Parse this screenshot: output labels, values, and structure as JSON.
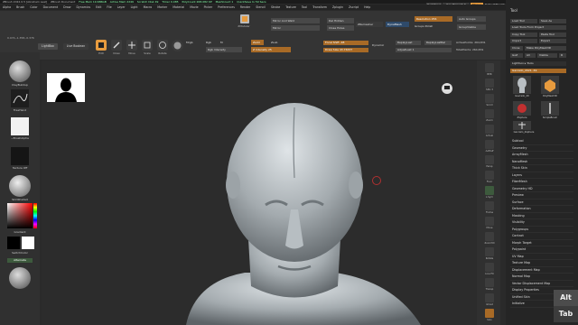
{
  "title_bar": {
    "app": "ZBrush 2022.0.5 [Abraham Leal]",
    "document": "ZBrush Document",
    "free_mem": "Free Mem 19.686GB",
    "active_mem": "Active Mem 2249",
    "scratch_disk": "Scratch Disk 49",
    "timer": "Timer 0.085",
    "poly_count": "PolyCount 268.082 KP",
    "mesh_count": "MeshCount 1",
    "quicksave": "QuickSave In 59 Secs",
    "quicksave_btn": "QuickSave",
    "see_through": "See-through 0",
    "menus_btn": "Menus",
    "default_script": "DefaultZScript"
  },
  "menubar": [
    "Alpha",
    "Brush",
    "Color",
    "Document",
    "Draw",
    "Dynamics",
    "Edit",
    "File",
    "Layer",
    "Light",
    "Macro",
    "Marker",
    "Material",
    "Movie",
    "Picker",
    "Preferences",
    "Render",
    "Stencil",
    "Stroke",
    "Texture",
    "Tool",
    "Transform",
    "Zplugin",
    "Zscript",
    "Help"
  ],
  "toolbar": {
    "coords": "0.074,-1.358,-0.376",
    "lightbox": "LightBox",
    "live_boolean": "Live Boolean",
    "edit": "Edit",
    "draw": "Draw",
    "move": "Move",
    "scale": "Scale",
    "rotate": "Rotate",
    "mrgb": "Mrgb",
    "rgb": "Rgb",
    "m": "M",
    "zadd": "Zadd",
    "zsub": "Zsub",
    "rgb_intensity": "Rgb Intensity",
    "z_intensity": "Z Intensity 25",
    "zmodeler": "ZModeler",
    "mirror_and_weld": "Mirror And Weld",
    "mirror": "Mirror",
    "del_hidden": "Del Hidden",
    "close_holes": "Close Holes",
    "zremesher": "ZRemesher",
    "dynamesh": "DynaMesh",
    "resolution": "Resolution 256",
    "groups_polish": "Groups  Polish",
    "auto_groups": "Auto Groups",
    "group_visible": "GroupVisible",
    "focal_shift": "Focal Shift -48",
    "draw_size": "Draw Size 43.76337",
    "dynamic": "Dynamic",
    "replay_last": "ReplayLast",
    "replay_last_rel": "ReplayLastRel",
    "adjust_last": "AdjustLast 1",
    "active_points": "ActivePoints: 264,831",
    "total_points": "TotalPoints: 264,831"
  },
  "left_shelf": {
    "brush": "ClayBuildup",
    "stroke": "FreeHand",
    "alpha": "~BrushAlpha",
    "texture": "Texture Off",
    "material": "SkinShade4",
    "gradient": "Gradient",
    "switch_color": "SwitchColor",
    "alternate": "Alternate"
  },
  "right_shelf": [
    "BPR",
    "SPix 3",
    "Scroll",
    "Zoom",
    "Actual",
    "AAHalf",
    "Persp",
    "Floor",
    "L.Sym",
    "Frame",
    "Move",
    "Zoom3D",
    "Rotate",
    "Line Fill",
    "Transp",
    "Ghost",
    "Solo",
    "Xpose"
  ],
  "tool_tray": {
    "header": "Tool",
    "load_tool": "Load Tool",
    "save_as": "Save As",
    "load_from_project": "Load Tools From Project",
    "copy_tool": "Copy Tool",
    "paste_tool": "Paste Tool",
    "import": "Import",
    "export": "Export",
    "clone": "Clone",
    "make_polymesh": "Make PolyMesh3D",
    "goz": "GoZ",
    "all": "All",
    "visible": "Visible",
    "r": "R",
    "lightbox_tools": "Lightbox ▸ Tools",
    "current_tool": "Gavrailo_2021. 49",
    "thumbnails": [
      "Gavrailo_20",
      "PolyMesh3D",
      "SimpleBrush",
      "ZSphere",
      "Gavrailo_20",
      "Gavrailo_Zsphere"
    ],
    "menu": [
      "Subtool",
      "Geometry",
      "ArrayMesh",
      "NanoMesh",
      "Thick Skin",
      "Layers",
      "FiberMesh",
      "Geometry HD",
      "Preview",
      "Surface",
      "Deformation",
      "Masking",
      "Visibility",
      "Polygroups",
      "Contact",
      "Morph Target",
      "Polypaint",
      "UV Map",
      "Texture Map",
      "Displacement Map",
      "Normal Map",
      "Vector Displacement Map",
      "Display Properties",
      "Unified Skin",
      "Initialize",
      "Import"
    ]
  },
  "overlay": {
    "alt": "Alt",
    "tab": "Tab"
  },
  "colors": {
    "accent": "#e79b3e",
    "background": "#2c2c2c",
    "panel": "#343434",
    "skin": "#a9b0b4"
  }
}
